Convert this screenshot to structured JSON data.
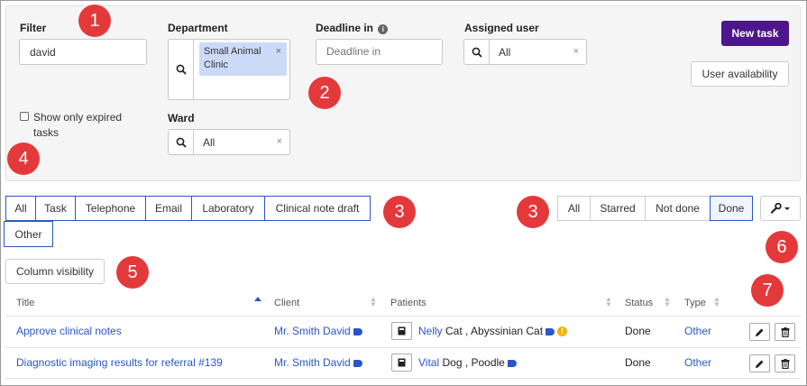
{
  "filters": {
    "filter_label": "Filter",
    "filter_value": "david",
    "department_label": "Department",
    "department_chip": "Small Animal Clinic",
    "deadline_label": "Deadline in",
    "deadline_placeholder": "Deadline in",
    "assigned_label": "Assigned user",
    "assigned_value": "All",
    "ward_label": "Ward",
    "ward_value": "All",
    "expired_label": "Show only expired tasks",
    "clear_glyph": "×"
  },
  "actions": {
    "new_task": "New task",
    "user_availability": "User availability",
    "column_visibility": "Column visibility"
  },
  "type_tabs": [
    "All",
    "Task",
    "Telephone",
    "Email",
    "Laboratory",
    "Clinical note draft",
    "Other"
  ],
  "status_tabs": [
    "All",
    "Starred",
    "Not done",
    "Done"
  ],
  "markers": [
    "1",
    "2",
    "3",
    "3",
    "4",
    "5",
    "6",
    "7"
  ],
  "table": {
    "columns": [
      "Title",
      "Client",
      "Patients",
      "Status",
      "Type"
    ],
    "rows": [
      {
        "title": "Approve clinical notes",
        "client": "Mr. Smith David",
        "patient_name": "Nelly",
        "patient_rest": " Cat , Abyssinian Cat",
        "status": "Done",
        "type": "Other"
      },
      {
        "title": "Diagnostic imaging results for referral #139",
        "client": "Mr. Smith David",
        "patient_name": "Vital",
        "patient_rest": " Dog , Poodle",
        "status": "Done",
        "type": "Other"
      }
    ]
  },
  "colors": {
    "primary": "#4d168a",
    "link": "#2a56c6",
    "marker": "#e4393b",
    "warning": "#f4b400"
  }
}
